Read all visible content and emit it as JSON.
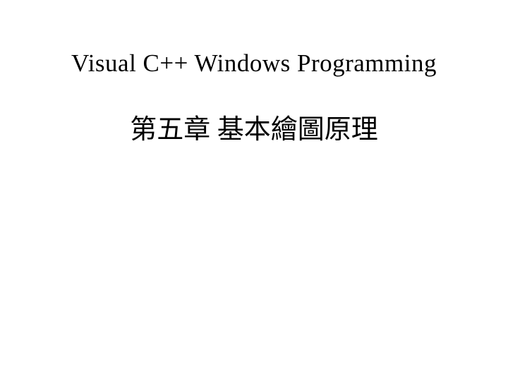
{
  "slide": {
    "title_en": "Visual C++ Windows Programming",
    "title_zh": "第五章  基本繪圖原理"
  }
}
